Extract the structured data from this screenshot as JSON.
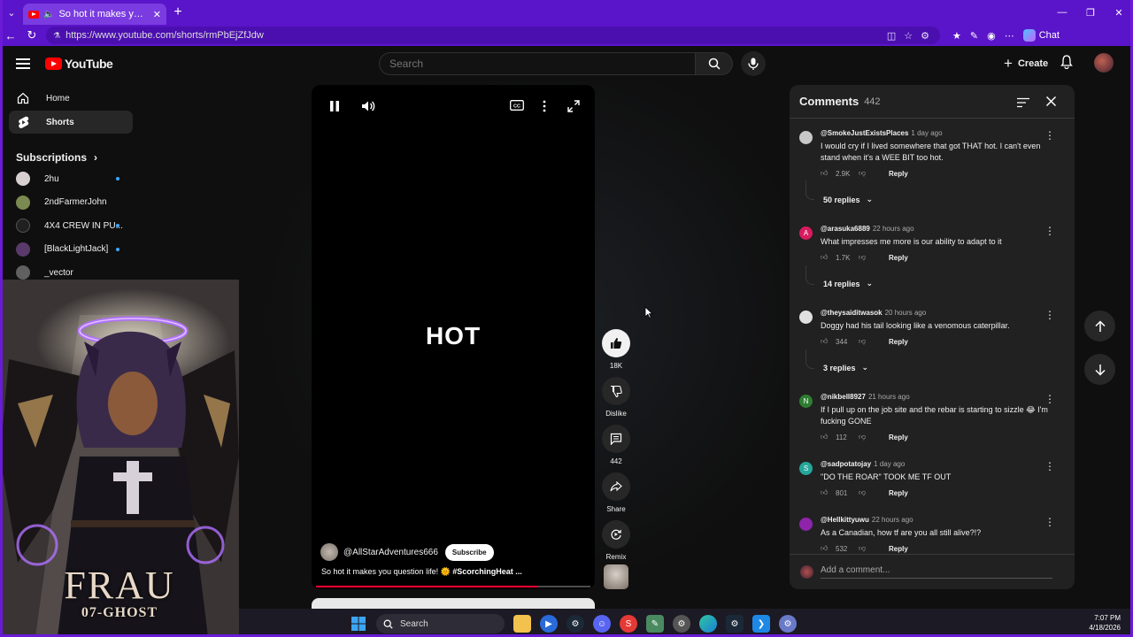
{
  "browser": {
    "tab_title": "So hot it makes you question",
    "url": "https://www.youtube.com/shorts/rmPbEjZfJdw",
    "chat_label": "Chat"
  },
  "header": {
    "logo_text": "YouTube",
    "search_placeholder": "Search",
    "create_label": "Create"
  },
  "sidebar": {
    "items": [
      {
        "label": "Home",
        "icon": "home-icon"
      },
      {
        "label": "Shorts",
        "icon": "shorts-icon"
      }
    ],
    "subscriptions_label": "Subscriptions",
    "subscriptions": [
      {
        "name": "2hu",
        "color": "#d8d0d0",
        "dot": true
      },
      {
        "name": "2ndFarmerJohn",
        "color": "#7a8a50",
        "dot": false
      },
      {
        "name": "4X4 CREW IN PU...",
        "color": "#202020",
        "dot": true
      },
      {
        "name": "[BlackLightJack]",
        "color": "#5a3a6a",
        "dot": true
      },
      {
        "name": "_vector",
        "color": "#606060",
        "dot": false
      }
    ]
  },
  "overlay_art": {
    "title": "FRAU",
    "subtitle": "07-GHOST"
  },
  "player": {
    "video_text": "HOT",
    "channel": "@AllStarAdventures666",
    "subscribe_label": "Subscribe",
    "caption_text": "So hot it makes you question life! 🌞 ",
    "caption_hashtag": "#ScorchingHeat ...",
    "progress": 0.81
  },
  "actions": {
    "likes": "18K",
    "dislike_label": "Dislike",
    "comments": "442",
    "share_label": "Share",
    "remix_label": "Remix"
  },
  "comments": {
    "title": "Comments",
    "count": "442",
    "add_placeholder": "Add a comment...",
    "items": [
      {
        "author": "@SmokeJustExistsPlaces",
        "time": "1 day ago",
        "text": "I would cry if I lived somewhere that got THAT hot. I can't even stand when it's a WEE BIT too hot.",
        "likes": "2.9K",
        "replies": "50 replies",
        "avatar_color": "#c8c8c8",
        "initial": ""
      },
      {
        "author": "@arasuka6889",
        "time": "22 hours ago",
        "text": "What impresses me more is our ability to adapt to it",
        "likes": "1.7K",
        "replies": "14 replies",
        "avatar_color": "#d81b60",
        "initial": "A"
      },
      {
        "author": "@theysaiditwasok",
        "time": "20 hours ago",
        "text": "Doggy had his tail looking like a venomous caterpillar.",
        "likes": "344",
        "replies": "3 replies",
        "avatar_color": "#e0e0e0",
        "initial": ""
      },
      {
        "author": "@nikbell8927",
        "time": "21 hours ago",
        "text": "If I pull up on the job site and the rebar is starting to sizzle 😂 I'm fucking GONE",
        "likes": "112",
        "replies": "",
        "avatar_color": "#2e7d32",
        "initial": "N"
      },
      {
        "author": "@sadpotatojay",
        "time": "1 day ago",
        "text": "\"DO THE ROAR\" TOOK ME TF OUT",
        "likes": "801",
        "replies": "",
        "avatar_color": "#26a69a",
        "initial": "S"
      },
      {
        "author": "@Hellkittyuwu",
        "time": "22 hours ago",
        "text": "As a Canadian, how tf are you all still alive?!?",
        "likes": "532",
        "replies": "",
        "avatar_color": "#8e24aa",
        "initial": ""
      }
    ],
    "reply_label": "Reply"
  },
  "taskbar": {
    "search_label": "Search",
    "time": "7:07 PM",
    "date": "4/18/2026"
  },
  "colors": {
    "accent_chrome": "#5a14c9",
    "youtube_red": "#ff0000",
    "progress_red": "#ff0033"
  }
}
